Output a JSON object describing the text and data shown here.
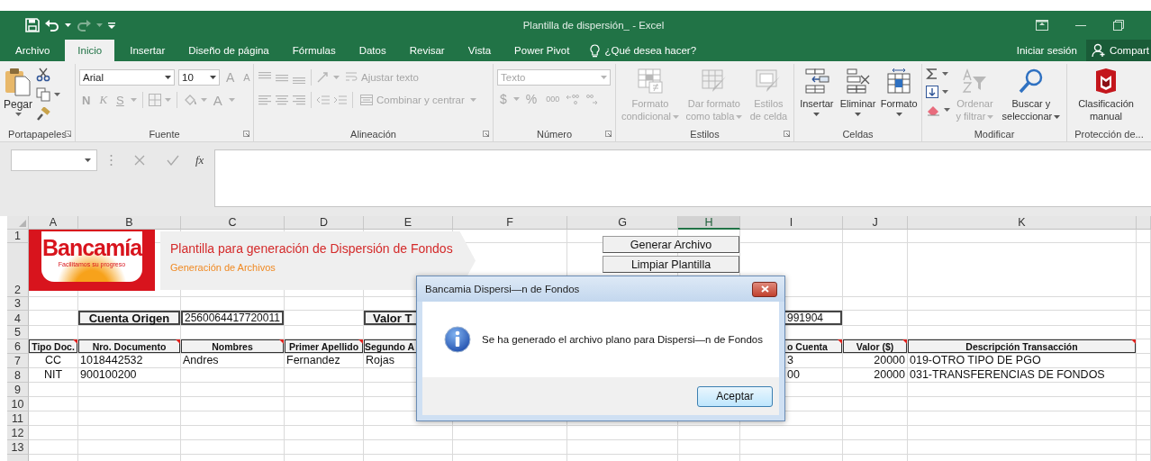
{
  "window": {
    "title": "Plantilla de dispersión_ - Excel"
  },
  "tabs": [
    {
      "label": "Archivo",
      "selected": false
    },
    {
      "label": "Inicio",
      "selected": true
    },
    {
      "label": "Insertar",
      "selected": false
    },
    {
      "label": "Diseño de página",
      "selected": false
    },
    {
      "label": "Fórmulas",
      "selected": false
    },
    {
      "label": "Datos",
      "selected": false
    },
    {
      "label": "Revisar",
      "selected": false
    },
    {
      "label": "Vista",
      "selected": false
    },
    {
      "label": "Power Pivot",
      "selected": false
    }
  ],
  "tell_me": "¿Qué desea hacer?",
  "account": {
    "sign_in": "Iniciar sesión",
    "share": "Compart"
  },
  "ribbon": {
    "clipboard": {
      "label": "Portapapeles",
      "paste": "Pegar"
    },
    "font": {
      "label": "Fuente",
      "font": "Arial",
      "size": "10",
      "grow": "A",
      "shrink": "A",
      "bold": "N",
      "italic": "K",
      "underline": "S",
      "font_color": "A",
      "disabled": true
    },
    "alignment": {
      "label": "Alineación",
      "wrap": "Ajustar texto",
      "merge": "Combinar y centrar",
      "disabled": true
    },
    "number": {
      "label": "Número",
      "format": "Texto",
      "currency": "$",
      "percent": "%",
      "thousands": "000",
      "disabled": true
    },
    "styles": {
      "label": "Estilos",
      "commands": [
        {
          "label": "Formato condicional",
          "disabled": true
        },
        {
          "label": "Dar formato como tabla",
          "disabled": true
        },
        {
          "label": "Estilos de celda",
          "disabled": true
        }
      ]
    },
    "cells": {
      "label": "Celdas",
      "commands": [
        {
          "label": "Insertar",
          "disabled": false
        },
        {
          "label": "Eliminar",
          "disabled": false
        },
        {
          "label": "Formato",
          "disabled": false
        }
      ]
    },
    "editing": {
      "label": "Modificar",
      "commands": [
        {
          "label": "Ordenar y filtrar",
          "disabled": true
        },
        {
          "label": "Buscar y seleccionar",
          "disabled": false
        }
      ]
    },
    "protection": {
      "label": "Protección de...",
      "commands": [
        {
          "label": "Clasificación manual",
          "disabled": false
        }
      ]
    }
  },
  "formula_bar": {
    "function": "fx"
  },
  "sheet": {
    "columns": [
      {
        "label": "A",
        "selected": false
      },
      {
        "label": "B",
        "selected": false
      },
      {
        "label": "C",
        "selected": false
      },
      {
        "label": "D",
        "selected": false
      },
      {
        "label": "E",
        "selected": false
      },
      {
        "label": "F",
        "selected": false
      },
      {
        "label": "G",
        "selected": false
      },
      {
        "label": "H",
        "selected": true
      },
      {
        "label": "I",
        "selected": false
      },
      {
        "label": "J",
        "selected": false
      },
      {
        "label": "K",
        "selected": false
      }
    ],
    "rows": [
      {
        "number": "1"
      },
      {
        "number": "2"
      },
      {
        "number": "3"
      },
      {
        "number": "4",
        "cells": {
          "B": {
            "text": "Cuenta Origen",
            "kind": "label"
          },
          "C": {
            "text": "2560064417720011",
            "kind": "value"
          },
          "E": {
            "text": "Valor T",
            "kind": "label"
          },
          "I": {
            "text": "991904",
            "kind": "value"
          }
        }
      },
      {
        "number": "5"
      },
      {
        "number": "6",
        "cells": {
          "A": {
            "text": "Tipo Doc.",
            "kind": "header",
            "comment": true
          },
          "B": {
            "text": "Nro. Documento",
            "kind": "header",
            "comment": true
          },
          "C": {
            "text": "Nombres",
            "kind": "header",
            "comment": true
          },
          "D": {
            "text": "Primer Apellido",
            "kind": "header",
            "comment": true
          },
          "E": {
            "text": "Segundo A",
            "kind": "header"
          },
          "I": {
            "text": "o Cuenta",
            "kind": "header",
            "comment": true
          },
          "J": {
            "text": "Valor ($)",
            "kind": "header",
            "comment": true
          },
          "K": {
            "text": "Descripción Transacción",
            "kind": "header",
            "comment": true
          }
        }
      },
      {
        "number": "7",
        "cells": {
          "A": {
            "text": "CC",
            "kind": "center"
          },
          "B": {
            "text": "1018442532",
            "kind": "text"
          },
          "C": {
            "text": "Andres",
            "kind": "text"
          },
          "D": {
            "text": "Fernandez",
            "kind": "text"
          },
          "E": {
            "text": "Rojas",
            "kind": "text"
          },
          "I": {
            "text": "3",
            "kind": "text"
          },
          "J": {
            "text": "20000",
            "kind": "number"
          },
          "K": {
            "text": "019-OTRO TIPO DE PGO",
            "kind": "text"
          }
        }
      },
      {
        "number": "8",
        "cells": {
          "A": {
            "text": "NIT",
            "kind": "center"
          },
          "B": {
            "text": "900100200",
            "kind": "text"
          },
          "I": {
            "text": "00",
            "kind": "text"
          },
          "J": {
            "text": "20000",
            "kind": "number"
          },
          "K": {
            "text": "031-TRANSFERENCIAS DE FONDOS",
            "kind": "text"
          }
        }
      },
      {
        "number": "9"
      },
      {
        "number": "10"
      },
      {
        "number": "11"
      },
      {
        "number": "12"
      },
      {
        "number": "13"
      }
    ],
    "logo": {
      "name": "Bancamía",
      "tagline": "Facilitamos su progreso"
    },
    "banner": {
      "title": "Plantilla para generación de Dispersión de Fondos",
      "subtitle": "Generación de Archivos"
    },
    "buttons": [
      "Generar Archivo",
      "Limpiar Plantilla"
    ]
  },
  "dialog": {
    "title": "Bancamia Dispersi—n de Fondos",
    "message": "Se ha generado el archivo plano para Dispersi—n de Fondos",
    "button": "Aceptar"
  }
}
